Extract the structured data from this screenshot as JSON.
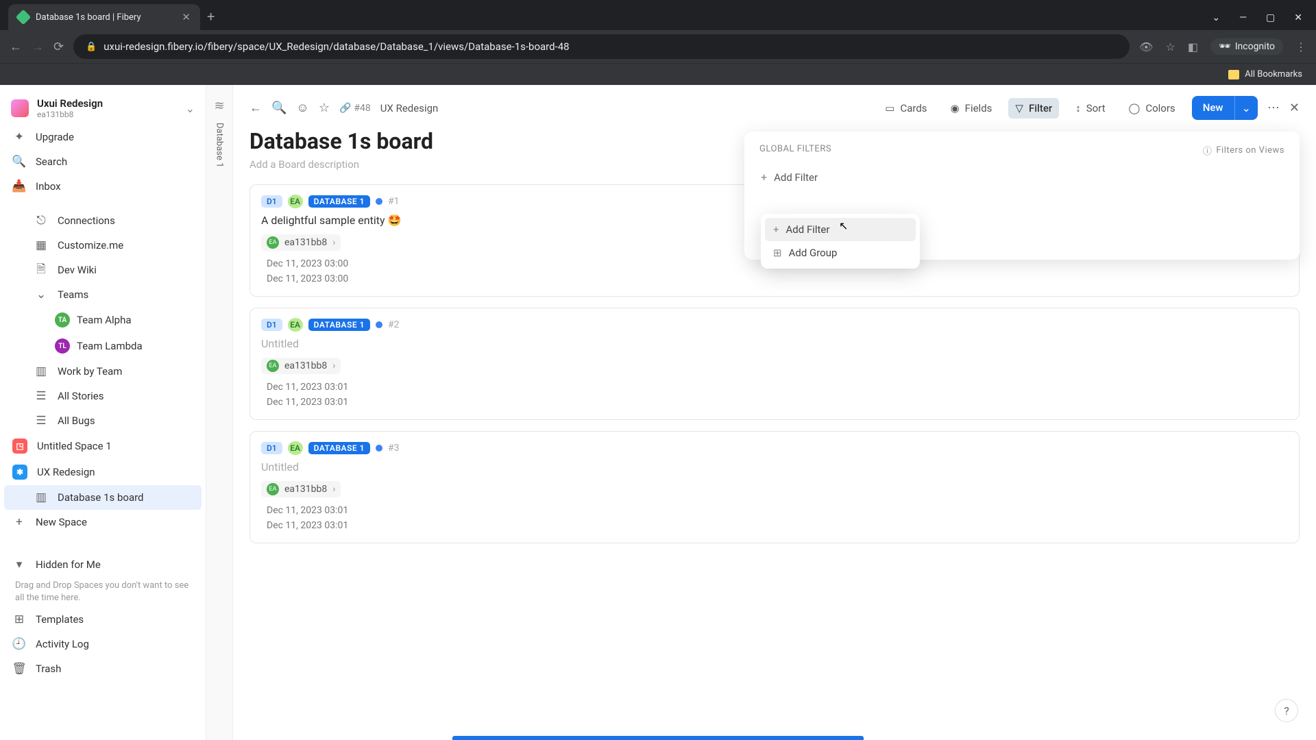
{
  "browser": {
    "tab_title": "Database 1s board | Fibery",
    "url": "uxui-redesign.fibery.io/fibery/space/UX_Redesign/database/Database_1/views/Database-1s-board-48",
    "incognito_label": "Incognito",
    "bookmarks_label": "All Bookmarks"
  },
  "workspace": {
    "name": "Uxui Redesign",
    "user": "ea131bb8"
  },
  "sidebar": {
    "upgrade": "Upgrade",
    "search": "Search",
    "inbox": "Inbox",
    "connections": "Connections",
    "customize": "Customize.me",
    "devwiki": "Dev Wiki",
    "teams": "Teams",
    "team_alpha": "Team Alpha",
    "team_lambda": "Team Lambda",
    "work_by_team": "Work by Team",
    "all_stories": "All Stories",
    "all_bugs": "All Bugs",
    "untitled_space": "Untitled Space 1",
    "ux_redesign": "UX Redesign",
    "db1_board": "Database 1s board",
    "new_space": "New Space",
    "hidden": "Hidden for Me",
    "hidden_hint": "Drag and Drop Spaces you don't want to see all the time here.",
    "templates": "Templates",
    "activity": "Activity Log",
    "trash": "Trash"
  },
  "colstrip": {
    "label": "Database 1"
  },
  "topbar": {
    "id": "#48",
    "breadcrumb": "UX Redesign",
    "cards": "Cards",
    "fields": "Fields",
    "filter": "Filter",
    "sort": "Sort",
    "colors": "Colors",
    "new": "New"
  },
  "board": {
    "title": "Database 1s board",
    "desc_placeholder": "Add a Board description"
  },
  "cards": [
    {
      "tag_d1": "D1",
      "tag_ea": "EA",
      "tag_db": "DATABASE 1",
      "num": "#1",
      "title": "A delightful sample entity 🤩",
      "user": "ea131bb8",
      "date1": "Dec 11, 2023 03:00",
      "date2": "Dec 11, 2023 03:00",
      "muted": false
    },
    {
      "tag_d1": "D1",
      "tag_ea": "EA",
      "tag_db": "DATABASE 1",
      "num": "#2",
      "title": "Untitled",
      "user": "ea131bb8",
      "date1": "Dec 11, 2023 03:01",
      "date2": "Dec 11, 2023 03:01",
      "muted": true
    },
    {
      "tag_d1": "D1",
      "tag_ea": "EA",
      "tag_db": "DATABASE 1",
      "num": "#3",
      "title": "Untitled",
      "user": "ea131bb8",
      "date1": "Dec 11, 2023 03:01",
      "date2": "Dec 11, 2023 03:01",
      "muted": true
    }
  ],
  "filter_panel": {
    "heading": "GLOBAL FILTERS",
    "help": "Filters on Views",
    "add_filter": "Add Filter",
    "add_filter2": "Add Filter",
    "dd_add_filter": "Add Filter",
    "dd_add_group": "Add Group"
  }
}
